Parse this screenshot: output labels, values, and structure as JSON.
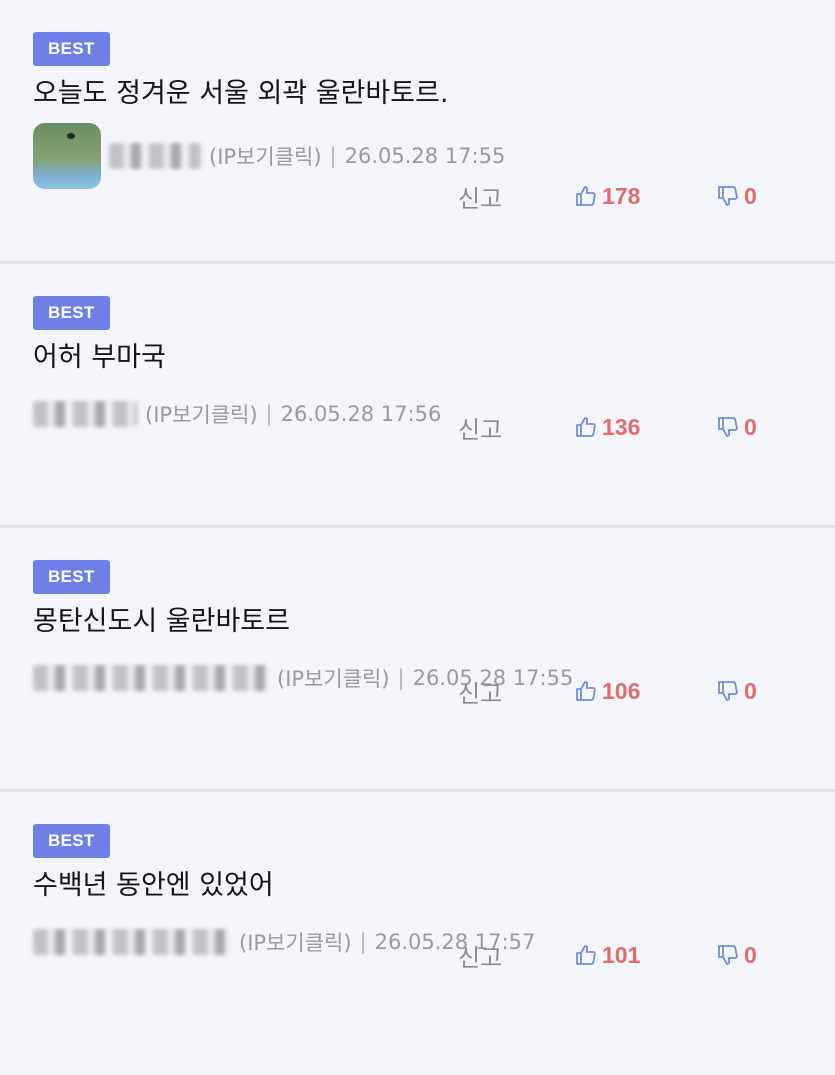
{
  "comments": [
    {
      "badge": "BEST",
      "text": "오늘도 정겨운 서울 외곽 울란바토르.",
      "ip": "(IP보기클릭)",
      "date": "26.05.28 17:55",
      "report": "신고",
      "likes": "178",
      "dislikes": "0",
      "has_avatar": true
    },
    {
      "badge": "BEST",
      "text": "어허 부마국",
      "ip": "(IP보기클릭)",
      "date": "26.05.28 17:56",
      "report": "신고",
      "likes": "136",
      "dislikes": "0",
      "has_avatar": false
    },
    {
      "badge": "BEST",
      "text": "몽탄신도시 울란바토르",
      "ip": "(IP보기클릭)",
      "date": "26.05.28 17:55",
      "report": "신고",
      "likes": "106",
      "dislikes": "0",
      "has_avatar": false
    },
    {
      "badge": "BEST",
      "text": "수백년 동안엔 있었어",
      "ip": "(IP보기클릭)",
      "date": "26.05.28 17:57",
      "report": "신고",
      "likes": "101",
      "dislikes": "0",
      "has_avatar": false
    }
  ],
  "icons": {
    "like": "thumbs-up-icon",
    "dislike": "thumbs-down-icon"
  },
  "colors": {
    "badge": "#6f7fe8",
    "count": "#e06c6c",
    "icon": "#6f8fd8"
  }
}
